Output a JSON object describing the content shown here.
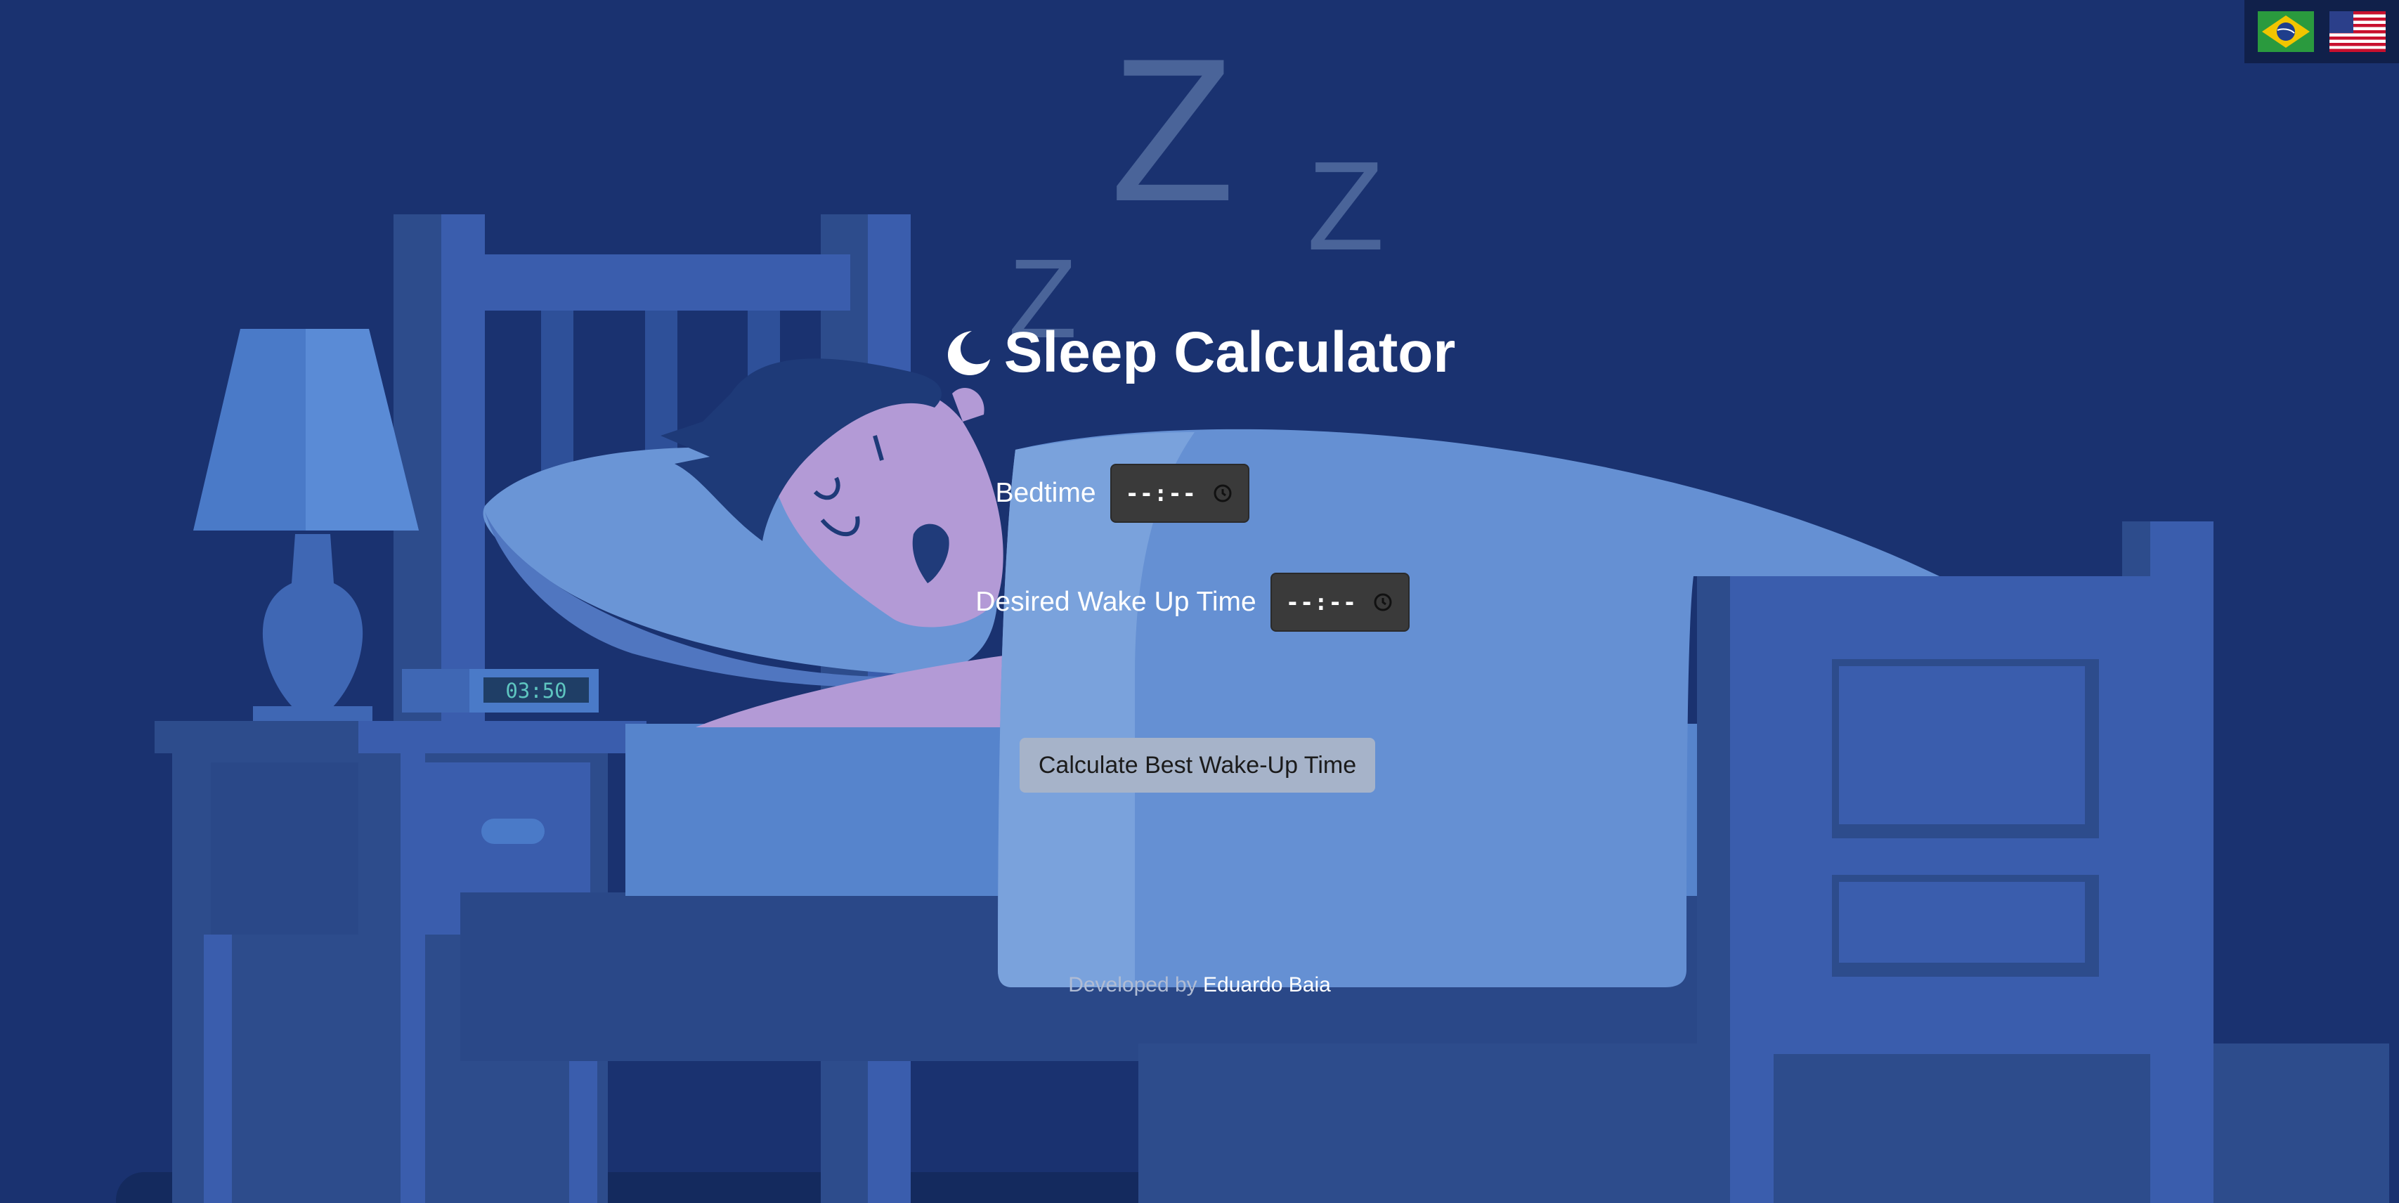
{
  "app": {
    "title": "Sleep Calculator",
    "title_icon": "crescent-moon-icon"
  },
  "language_switcher": [
    {
      "name": "brazil-flag-icon",
      "lang": "pt-BR"
    },
    {
      "name": "usa-flag-icon",
      "lang": "en-US"
    }
  ],
  "form": {
    "bedtime_label": "Bedtime",
    "bedtime_value": "--:--",
    "wake_label": "Desired Wake Up Time",
    "wake_value": "--:--",
    "calculate_label": "Calculate Best Wake-Up Time"
  },
  "footer": {
    "prefix": "Developed by",
    "author": "Eduardo Baia"
  },
  "illustration": {
    "clock_display": "03:50",
    "zzz": [
      "Z",
      "Z",
      "Z"
    ]
  },
  "colors": {
    "background": "#1a3270",
    "input_bg": "#3a3a3a",
    "button_bg": "#a6b3c9",
    "text": "#ffffff"
  }
}
